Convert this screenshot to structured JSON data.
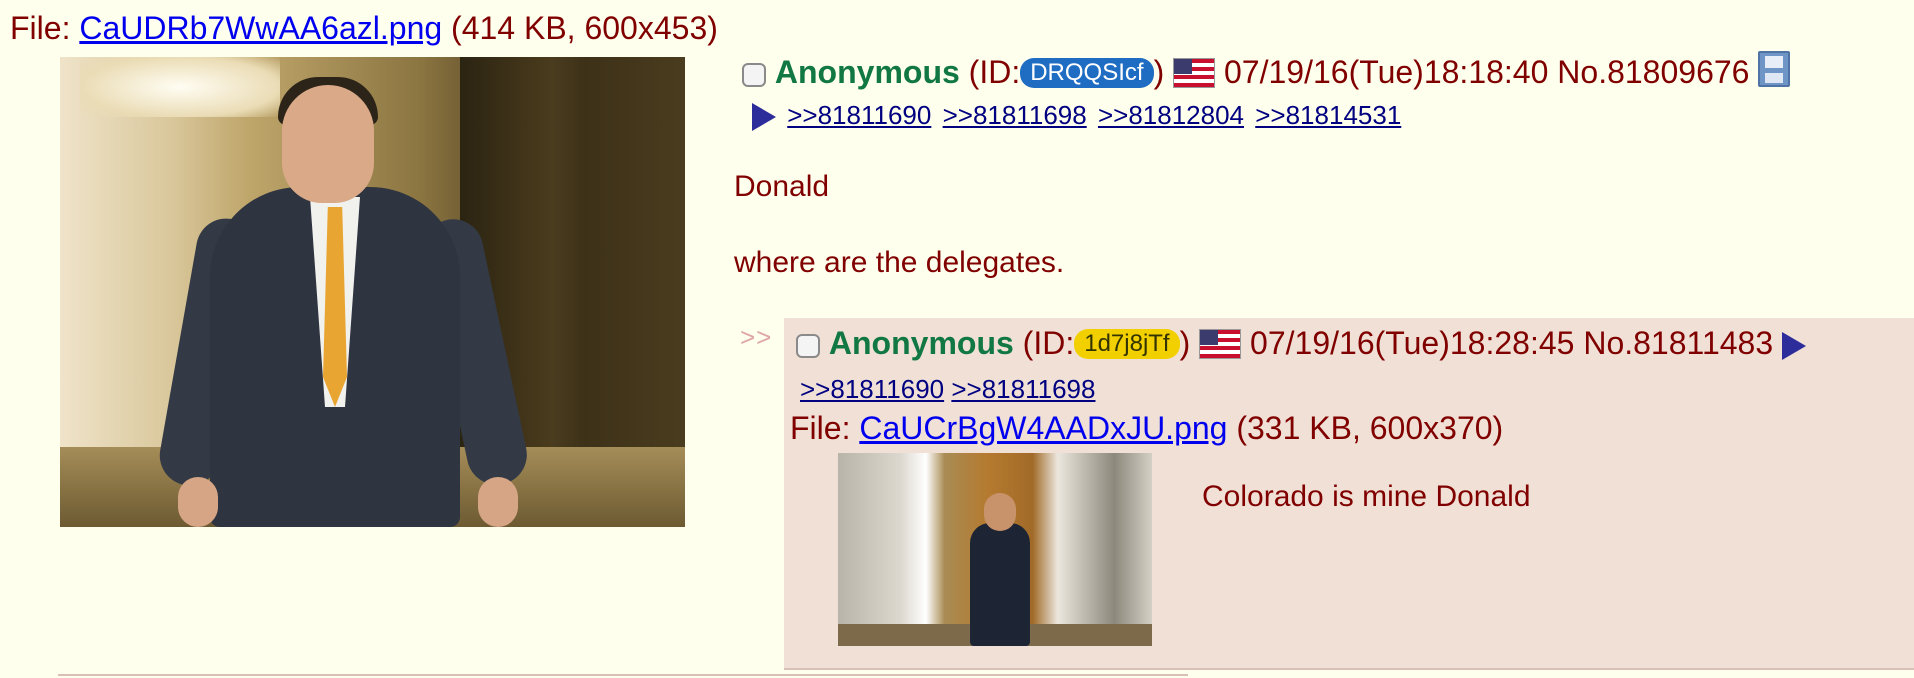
{
  "op": {
    "file_label": "File:",
    "file_name": "CaUDRb7WwAA6azl.png",
    "file_meta": "(414 KB, 600x453)",
    "name": "Anonymous",
    "id_prefix": "(ID:",
    "id_value": "DRQQSIcf",
    "id_suffix": ")",
    "datetime": "07/19/16(Tue)18:18:40",
    "post_no": "No.81809676",
    "backlinks": [
      ">>81811690",
      ">>81811698",
      ">>81812804",
      ">>81814531"
    ],
    "message_lines": [
      "Donald",
      "where are the delegates."
    ]
  },
  "reply": {
    "side_arrows": ">>",
    "name": "Anonymous",
    "id_prefix": "(ID:",
    "id_value": "1d7j8jTf",
    "id_suffix": ")",
    "datetime": "07/19/16(Tue)18:28:45",
    "post_no": "No.81811483",
    "backlinks": [
      ">>81811690",
      ">>81811698"
    ],
    "file_label": "File:",
    "file_name": "CaUCrBgW4AADxJU.png",
    "file_meta": "(331 KB, 600x370)",
    "message": "Colorado is mine Donald"
  },
  "colors": {
    "background": "#ffffee",
    "text": "#800000",
    "name": "#117743",
    "reply_bg": "#f0e0d6",
    "link": "#0000ee",
    "backlink": "#000080",
    "id_op_bg": "#1f6dc2",
    "id_reply_bg": "#f2d000"
  },
  "icons": {
    "flag": "us-flag-icon",
    "save": "save-icon",
    "expand": "triangle-right-icon"
  }
}
